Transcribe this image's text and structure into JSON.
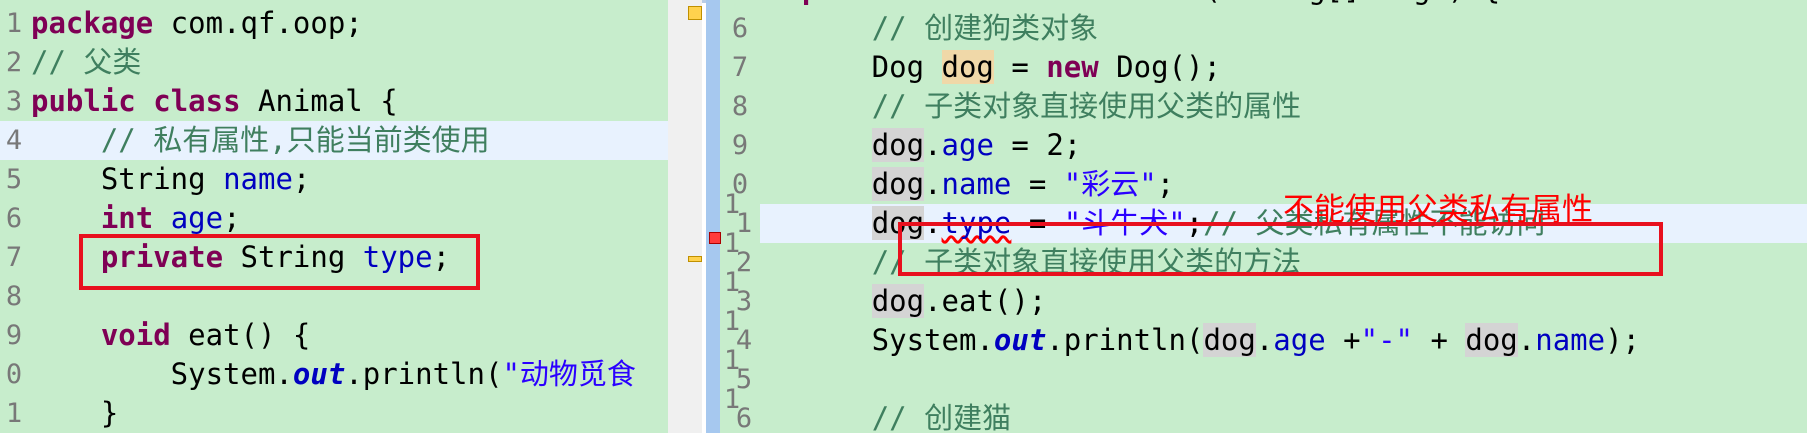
{
  "left_editor": {
    "lines": [
      {
        "num": "1",
        "parts": [
          {
            "t": "package",
            "c": "kw"
          },
          {
            "t": " com.qf.oop;"
          }
        ]
      },
      {
        "num": "2",
        "parts": [
          {
            "t": "// 父类",
            "c": "cm"
          }
        ]
      },
      {
        "num": "3",
        "parts": [
          {
            "t": "public",
            "c": "kw"
          },
          {
            "t": " "
          },
          {
            "t": "class",
            "c": "kw"
          },
          {
            "t": " Animal {"
          }
        ]
      },
      {
        "num": "4",
        "highlight": true,
        "parts": [
          {
            "t": "    "
          },
          {
            "t": "// 私有属性,只能当前类使用",
            "c": "cm"
          }
        ]
      },
      {
        "num": "5",
        "parts": [
          {
            "t": "    String "
          },
          {
            "t": "name",
            "c": "fd"
          },
          {
            "t": ";"
          }
        ]
      },
      {
        "num": "6",
        "parts": [
          {
            "t": "    "
          },
          {
            "t": "int",
            "c": "kw"
          },
          {
            "t": " "
          },
          {
            "t": "age",
            "c": "fd"
          },
          {
            "t": ";"
          }
        ]
      },
      {
        "num": "7",
        "parts": [
          {
            "t": "    "
          },
          {
            "t": "private",
            "c": "kw"
          },
          {
            "t": " String "
          },
          {
            "t": "type",
            "c": "fd"
          },
          {
            "t": ";"
          }
        ]
      },
      {
        "num": "8",
        "parts": []
      },
      {
        "num": "9",
        "parts": [
          {
            "t": "    "
          },
          {
            "t": "void",
            "c": "kw"
          },
          {
            "t": " eat() {"
          }
        ]
      },
      {
        "num": "0",
        "parts": [
          {
            "t": "        System."
          },
          {
            "t": "out",
            "c": "sf"
          },
          {
            "t": ".println("
          },
          {
            "t": "\"动物觅食",
            "c": "st"
          }
        ]
      },
      {
        "num": "1",
        "parts": [
          {
            "t": "    }"
          }
        ]
      }
    ]
  },
  "right_editor": {
    "line_numbers": [
      "6",
      "7",
      "8",
      "9",
      "0",
      "1",
      "2",
      "3",
      "4",
      "5",
      "6"
    ],
    "line_number_tens": [
      "",
      "",
      "",
      "",
      "",
      "1",
      "1",
      "1",
      "1",
      "1",
      "1"
    ],
    "lines": [
      {
        "parts": [
          {
            "t": "    "
          },
          {
            "t": "public",
            "c": "kw"
          },
          {
            "t": " "
          },
          {
            "t": "static",
            "c": "kw"
          },
          {
            "t": " "
          },
          {
            "t": "void",
            "c": "kw"
          },
          {
            "t": " main(String[] args) {"
          }
        ]
      },
      {
        "parts": [
          {
            "t": "        "
          },
          {
            "t": "// 创建狗类对象",
            "c": "cm"
          }
        ]
      },
      {
        "parts": [
          {
            "t": "        Dog "
          },
          {
            "t": "dog",
            "c": "occ"
          },
          {
            "t": " = "
          },
          {
            "t": "new",
            "c": "kw"
          },
          {
            "t": " Dog();"
          }
        ]
      },
      {
        "parts": [
          {
            "t": "        "
          },
          {
            "t": "// 子类对象直接使用父类的属性",
            "c": "cm"
          }
        ]
      },
      {
        "parts": [
          {
            "t": "        "
          },
          {
            "t": "dog",
            "c": "ref"
          },
          {
            "t": "."
          },
          {
            "t": "age",
            "c": "fd"
          },
          {
            "t": " = 2;"
          }
        ]
      },
      {
        "parts": [
          {
            "t": "        "
          },
          {
            "t": "dog",
            "c": "ref"
          },
          {
            "t": "."
          },
          {
            "t": "name",
            "c": "fd"
          },
          {
            "t": " = "
          },
          {
            "t": "\"彩云\"",
            "c": "st"
          },
          {
            "t": ";"
          }
        ]
      },
      {
        "highlight": true,
        "parts": [
          {
            "t": "        "
          },
          {
            "t": "dog",
            "c": "ref"
          },
          {
            "t": "."
          },
          {
            "t": "type",
            "c": "fd err"
          },
          {
            "t": " = "
          },
          {
            "t": "\"斗牛犬\"",
            "c": "st"
          },
          {
            "t": ";"
          },
          {
            "t": "// 父类私有属性不能访问",
            "c": "cm"
          }
        ]
      },
      {
        "parts": [
          {
            "t": "        "
          },
          {
            "t": "// 子类对象直接使用父类的方法",
            "c": "cm"
          }
        ]
      },
      {
        "parts": [
          {
            "t": "        "
          },
          {
            "t": "dog",
            "c": "ref"
          },
          {
            "t": ".eat();"
          }
        ]
      },
      {
        "parts": [
          {
            "t": "        System."
          },
          {
            "t": "out",
            "c": "sf"
          },
          {
            "t": ".println("
          },
          {
            "t": "dog",
            "c": "ref"
          },
          {
            "t": "."
          },
          {
            "t": "age",
            "c": "fd"
          },
          {
            "t": " +"
          },
          {
            "t": "\"-\"",
            "c": "st"
          },
          {
            "t": " + "
          },
          {
            "t": "dog",
            "c": "ref"
          },
          {
            "t": "."
          },
          {
            "t": "name",
            "c": "fd"
          },
          {
            "t": ");"
          }
        ]
      },
      {
        "parts": []
      },
      {
        "parts": [
          {
            "t": "        "
          },
          {
            "t": "// 创建猫",
            "c": "cm"
          }
        ]
      }
    ]
  },
  "annotation": {
    "note": "不能使用父类私有属性",
    "color": "#ff0000"
  },
  "colors": {
    "editor_bg": "#c7edcc",
    "keyword": "#7f0055",
    "comment": "#3f7f5f",
    "field": "#0000c0",
    "string": "#2a00ff",
    "current_line": "#e8f2fe"
  }
}
